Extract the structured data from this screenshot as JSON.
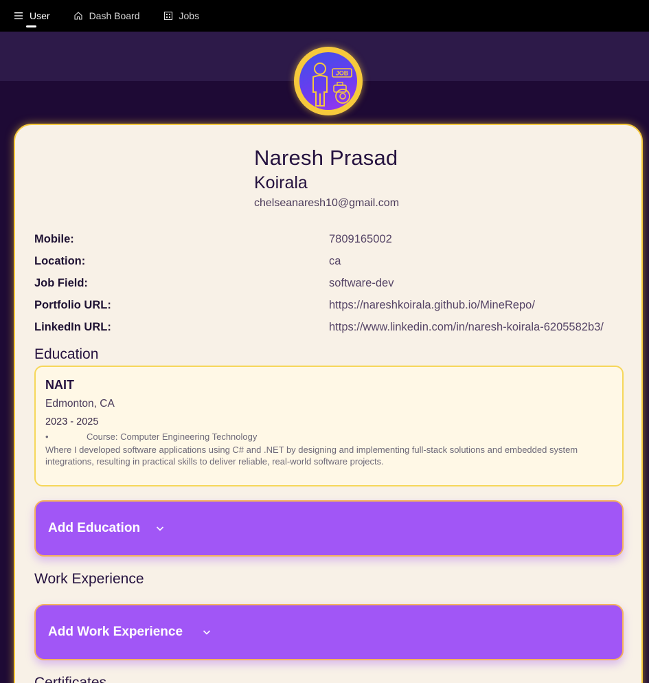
{
  "nav": {
    "items": [
      {
        "label": "User",
        "icon": "menu-icon"
      },
      {
        "label": "Dash Board",
        "icon": "home-icon"
      },
      {
        "label": "Jobs",
        "icon": "grid-icon"
      }
    ]
  },
  "avatar": {
    "badge_text": "JOB"
  },
  "profile": {
    "first_name": "Naresh Prasad",
    "last_name": "Koirala",
    "email": "chelseanaresh10@gmail.com"
  },
  "info": [
    {
      "label": "Mobile:",
      "value": "7809165002"
    },
    {
      "label": "Location:",
      "value": "ca"
    },
    {
      "label": "Job Field:",
      "value": "software-dev"
    },
    {
      "label": "Portfolio URL:",
      "value": "https://nareshkoirala.github.io/MineRepo/"
    },
    {
      "label": "LinkedIn URL:",
      "value": "https://www.linkedin.com/in/naresh-koirala-6205582b3/"
    }
  ],
  "education": {
    "title": "Education",
    "entry": {
      "school": "NAIT",
      "location": "Edmonton, CA",
      "years": "2023 - 2025",
      "bullet": "•",
      "course": "Course: Computer Engineering Technology",
      "description": "Where I developed software applications using C# and .NET by designing and implementing full-stack solutions and embedded system integrations, resulting in practical skills to deliver reliable, real-world software projects."
    },
    "add_label": "Add Education"
  },
  "work": {
    "title": "Work Experience",
    "add_label": "Add Work Experience"
  },
  "certificates": {
    "title": "Certificates"
  },
  "colors": {
    "nav_bg": "#000000",
    "page_bg": "#1e0a35",
    "accent": "#a156f6",
    "gold": "#f6c93c",
    "card_bg": "#f8f1e7"
  }
}
